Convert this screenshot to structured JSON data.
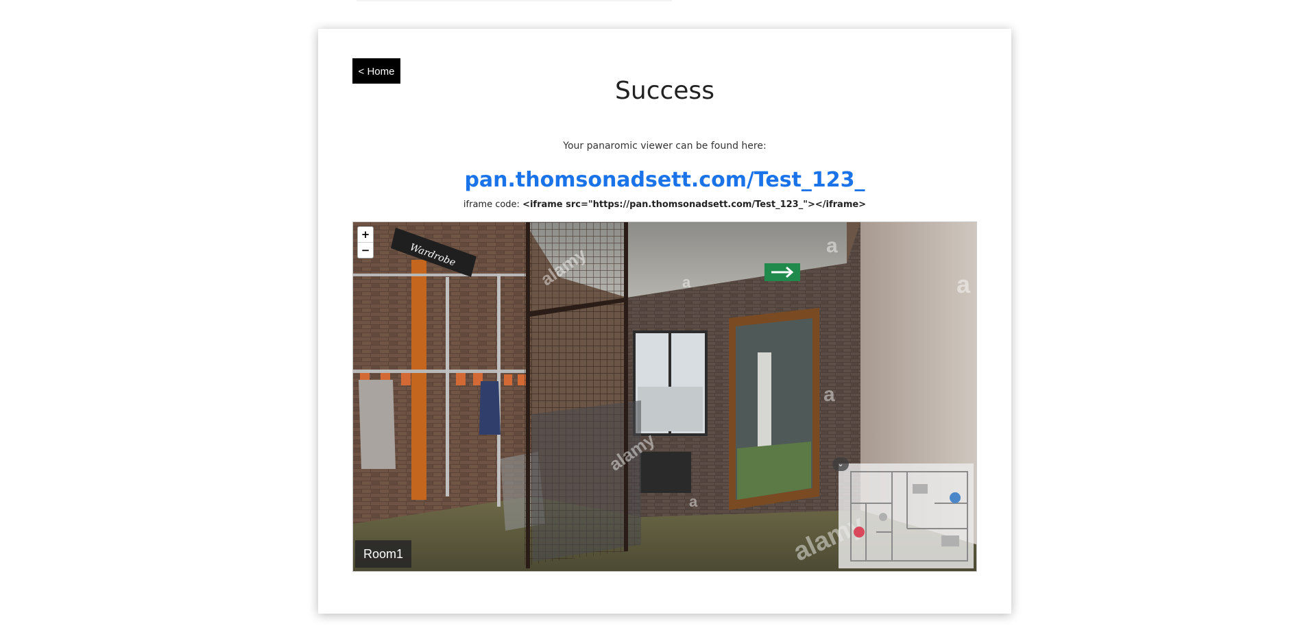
{
  "nav": {
    "home_label": "< Home"
  },
  "page": {
    "title": "Success",
    "subtext": "Your panaromic viewer can be found here:",
    "link_text": "pan.thomsonadsett.com/Test_123_",
    "iframe_prefix": "iframe code: ",
    "iframe_code": "<iframe src=\"https://pan.thomsonadsett.com/Test_123_\"></iframe>"
  },
  "viewer": {
    "zoom_in": "+",
    "zoom_out": "−",
    "room_label": "Room1",
    "sign_text": "Wardrobe",
    "watermark": "alamy",
    "watermark_short": "a",
    "minimap_toggle_icon": "chevron-down-icon"
  },
  "colors": {
    "link": "#1a73e8",
    "button_bg": "#000000",
    "hotspot_red": "#d9485b",
    "hotspot_blue": "#4a86c8"
  }
}
